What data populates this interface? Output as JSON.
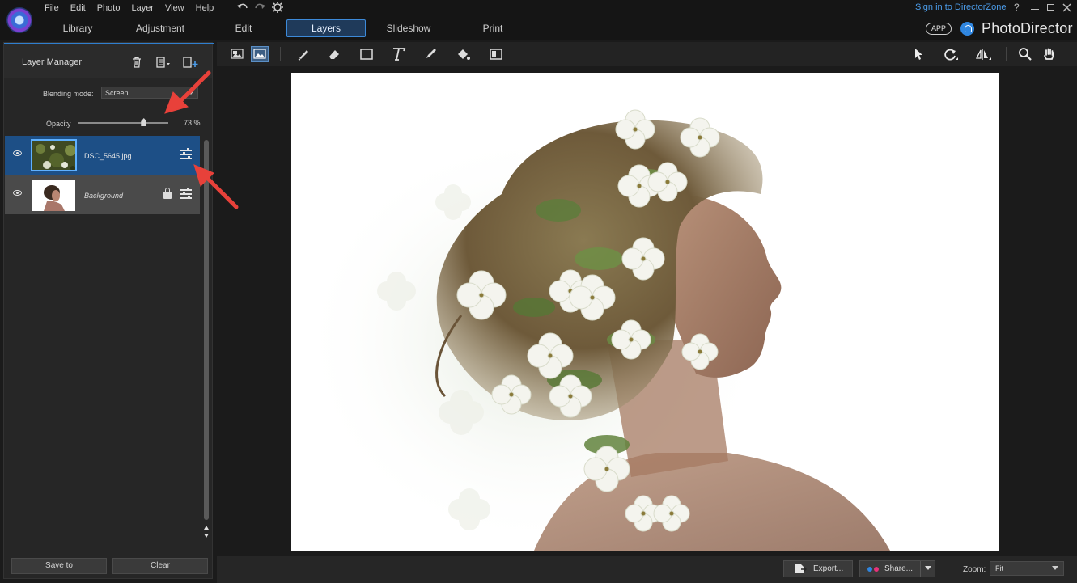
{
  "menu": {
    "items": [
      "File",
      "Edit",
      "Photo",
      "Layer",
      "View",
      "Help"
    ]
  },
  "modes": {
    "tabs": [
      {
        "label": "Library"
      },
      {
        "label": "Adjustment"
      },
      {
        "label": "Edit"
      },
      {
        "label": "Layers",
        "active": true
      },
      {
        "label": "Slideshow"
      },
      {
        "label": "Print"
      }
    ]
  },
  "account": {
    "signin": "Sign in to DirectorZone",
    "help": "?",
    "app_badge": "APP",
    "brand": "PhotoDirector"
  },
  "layer_manager": {
    "title": "Layer Manager",
    "blending_label": "Blending mode:",
    "blending_value": "Screen",
    "opacity_label": "Opacity",
    "opacity_value": "73",
    "opacity_unit": "%",
    "opacity_fraction": 0.73,
    "layers": [
      {
        "name": "DSC_5645.jpg",
        "selected": true,
        "locked": false
      },
      {
        "name": "Background",
        "selected": false,
        "locked": true
      }
    ]
  },
  "bottom_left": {
    "save_label": "Save to",
    "clear_label": "Clear"
  },
  "bottom_right": {
    "export_label": "Export...",
    "share_label": "Share...",
    "zoom_label": "Zoom:",
    "zoom_value": "Fit"
  },
  "colors": {
    "accent": "#2f7fd0",
    "selected_row": "#1d4f86",
    "link": "#4b9be8",
    "annotation_arrow": "#e8413a"
  },
  "icons": [
    "trash-icon",
    "duplicate-layer-icon",
    "add-layer-icon",
    "brush-icon",
    "eraser-icon",
    "rectangle-icon",
    "text-icon",
    "pen-icon",
    "fill-icon",
    "gradient-icon",
    "select-arrow-icon",
    "rotate-icon",
    "flip-icon",
    "zoom-icon",
    "hand-icon"
  ]
}
